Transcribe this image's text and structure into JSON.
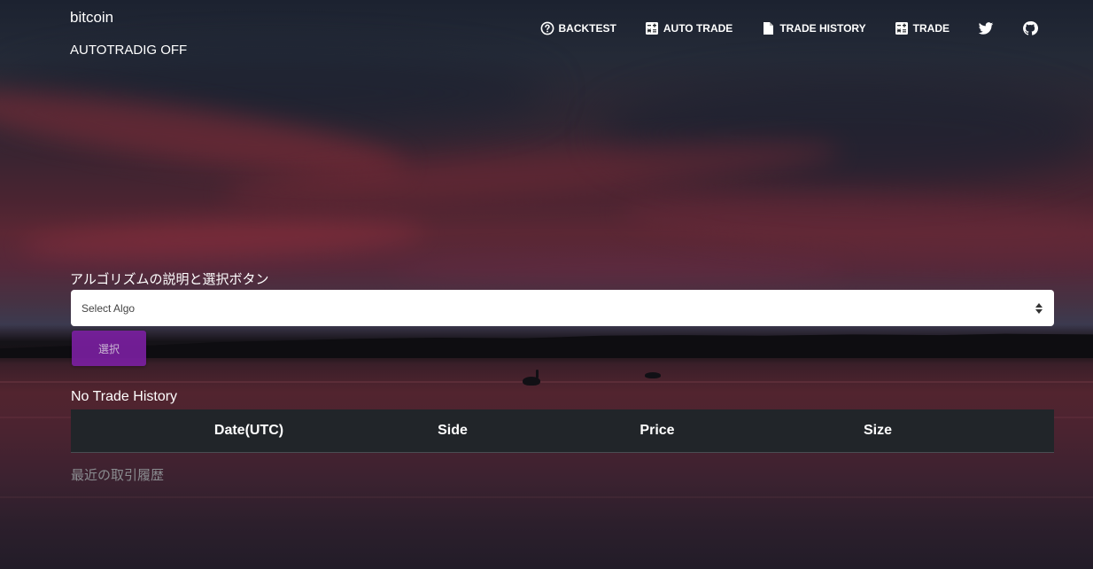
{
  "header": {
    "brand": "bitcoin",
    "status": "AUTOTRADIG OFF"
  },
  "nav": {
    "items": [
      {
        "label": "BACKTEST",
        "icon": "help-circle-icon"
      },
      {
        "label": "AUTO TRADE",
        "icon": "calculator-icon"
      },
      {
        "label": "TRADE HISTORY",
        "icon": "document-icon"
      },
      {
        "label": "TRADE",
        "icon": "calculator-icon"
      },
      {
        "label": "",
        "icon": "twitter-icon"
      },
      {
        "label": "",
        "icon": "github-icon"
      }
    ]
  },
  "algo": {
    "label": "アルゴリズムの説明と選択ボタン",
    "select_value": "Select Algo",
    "button_label": "選択"
  },
  "history": {
    "title": "No Trade History",
    "columns": [
      "Date(UTC)",
      "Side",
      "Price",
      "Size"
    ],
    "caption": "最近の取引履歴"
  },
  "colors": {
    "accent_button": "#7b1fa2",
    "table_header_bg": "#212529"
  }
}
